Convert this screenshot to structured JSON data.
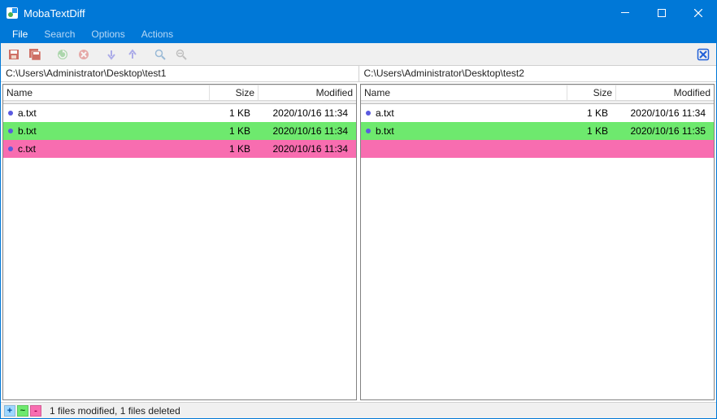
{
  "window": {
    "title": "MobaTextDiff"
  },
  "menu": {
    "file": "File",
    "search": "Search",
    "options": "Options",
    "actions": "Actions"
  },
  "paths": {
    "left": "C:\\Users\\Administrator\\Desktop\\test1",
    "right": "C:\\Users\\Administrator\\Desktop\\test2"
  },
  "columns": {
    "name": "Name",
    "size": "Size",
    "modified": "Modified"
  },
  "left": {
    "rows": [
      {
        "name": "a.txt",
        "size": "1 KB",
        "modified": "2020/10/16 11:34",
        "state": "same"
      },
      {
        "name": "b.txt",
        "size": "1 KB",
        "modified": "2020/10/16 11:34",
        "state": "mod"
      },
      {
        "name": "c.txt",
        "size": "1 KB",
        "modified": "2020/10/16 11:34",
        "state": "del"
      }
    ]
  },
  "right": {
    "rows": [
      {
        "name": "a.txt",
        "size": "1 KB",
        "modified": "2020/10/16 11:34",
        "state": "same"
      },
      {
        "name": "b.txt",
        "size": "1 KB",
        "modified": "2020/10/16 11:35",
        "state": "mod"
      },
      {
        "name": "",
        "size": "",
        "modified": "",
        "state": "empty"
      }
    ]
  },
  "legend": {
    "add": "+",
    "mod": "~",
    "del": "-"
  },
  "status": {
    "summary": "1 files modified, 1 files deleted"
  },
  "icons": {
    "save": "save-icon",
    "save_all": "save-all-icon",
    "refresh": "refresh-icon",
    "cancel": "cancel-icon",
    "down": "arrow-down-icon",
    "up": "arrow-up-icon",
    "zoom": "zoom-icon",
    "zoom_reset": "zoom-reset-icon",
    "close_right": "close-panel-icon"
  }
}
